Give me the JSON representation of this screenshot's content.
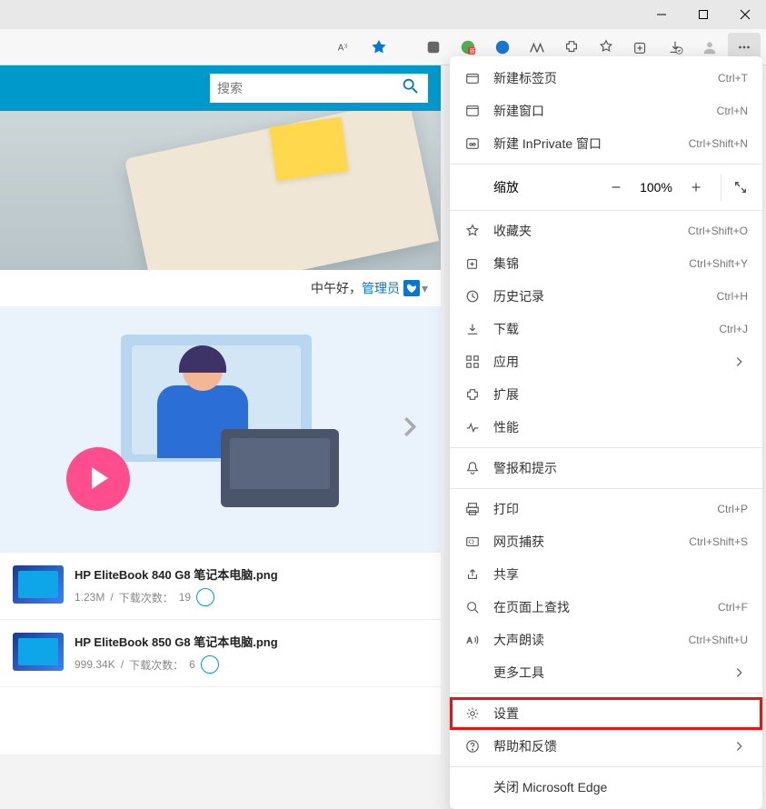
{
  "titlebar": {
    "minimize": "−",
    "maximize": "☐",
    "close": "✕"
  },
  "search": {
    "placeholder": "搜索"
  },
  "greeting": {
    "text": "中午好，",
    "admin": "管理员"
  },
  "files": [
    {
      "name": "HP EliteBook 840 G8 笔记本电脑.png",
      "size": "1.23M",
      "downloads_label": "下载次数：",
      "downloads": "19"
    },
    {
      "name": "HP EliteBook 850 G8 笔记本电脑.png",
      "size": "999.34K",
      "downloads_label": "下载次数：",
      "downloads": "6"
    }
  ],
  "menu": {
    "new_tab": {
      "label": "新建标签页",
      "shortcut": "Ctrl+T"
    },
    "new_window": {
      "label": "新建窗口",
      "shortcut": "Ctrl+N"
    },
    "new_inprivate": {
      "label": "新建 InPrivate 窗口",
      "shortcut": "Ctrl+Shift+N"
    },
    "zoom": {
      "label": "缩放",
      "value": "100%"
    },
    "favorites": {
      "label": "收藏夹",
      "shortcut": "Ctrl+Shift+O"
    },
    "collections": {
      "label": "集锦",
      "shortcut": "Ctrl+Shift+Y"
    },
    "history": {
      "label": "历史记录",
      "shortcut": "Ctrl+H"
    },
    "downloads": {
      "label": "下载",
      "shortcut": "Ctrl+J"
    },
    "apps": {
      "label": "应用"
    },
    "extensions": {
      "label": "扩展"
    },
    "performance": {
      "label": "性能"
    },
    "alerts": {
      "label": "警报和提示"
    },
    "print": {
      "label": "打印",
      "shortcut": "Ctrl+P"
    },
    "capture": {
      "label": "网页捕获",
      "shortcut": "Ctrl+Shift+S"
    },
    "share": {
      "label": "共享"
    },
    "find": {
      "label": "在页面上查找",
      "shortcut": "Ctrl+F"
    },
    "read_aloud": {
      "label": "大声朗读",
      "shortcut": "Ctrl+Shift+U"
    },
    "more_tools": {
      "label": "更多工具"
    },
    "settings": {
      "label": "设置"
    },
    "help": {
      "label": "帮助和反馈"
    },
    "close_edge": {
      "label": "关闭 Microsoft Edge"
    }
  }
}
